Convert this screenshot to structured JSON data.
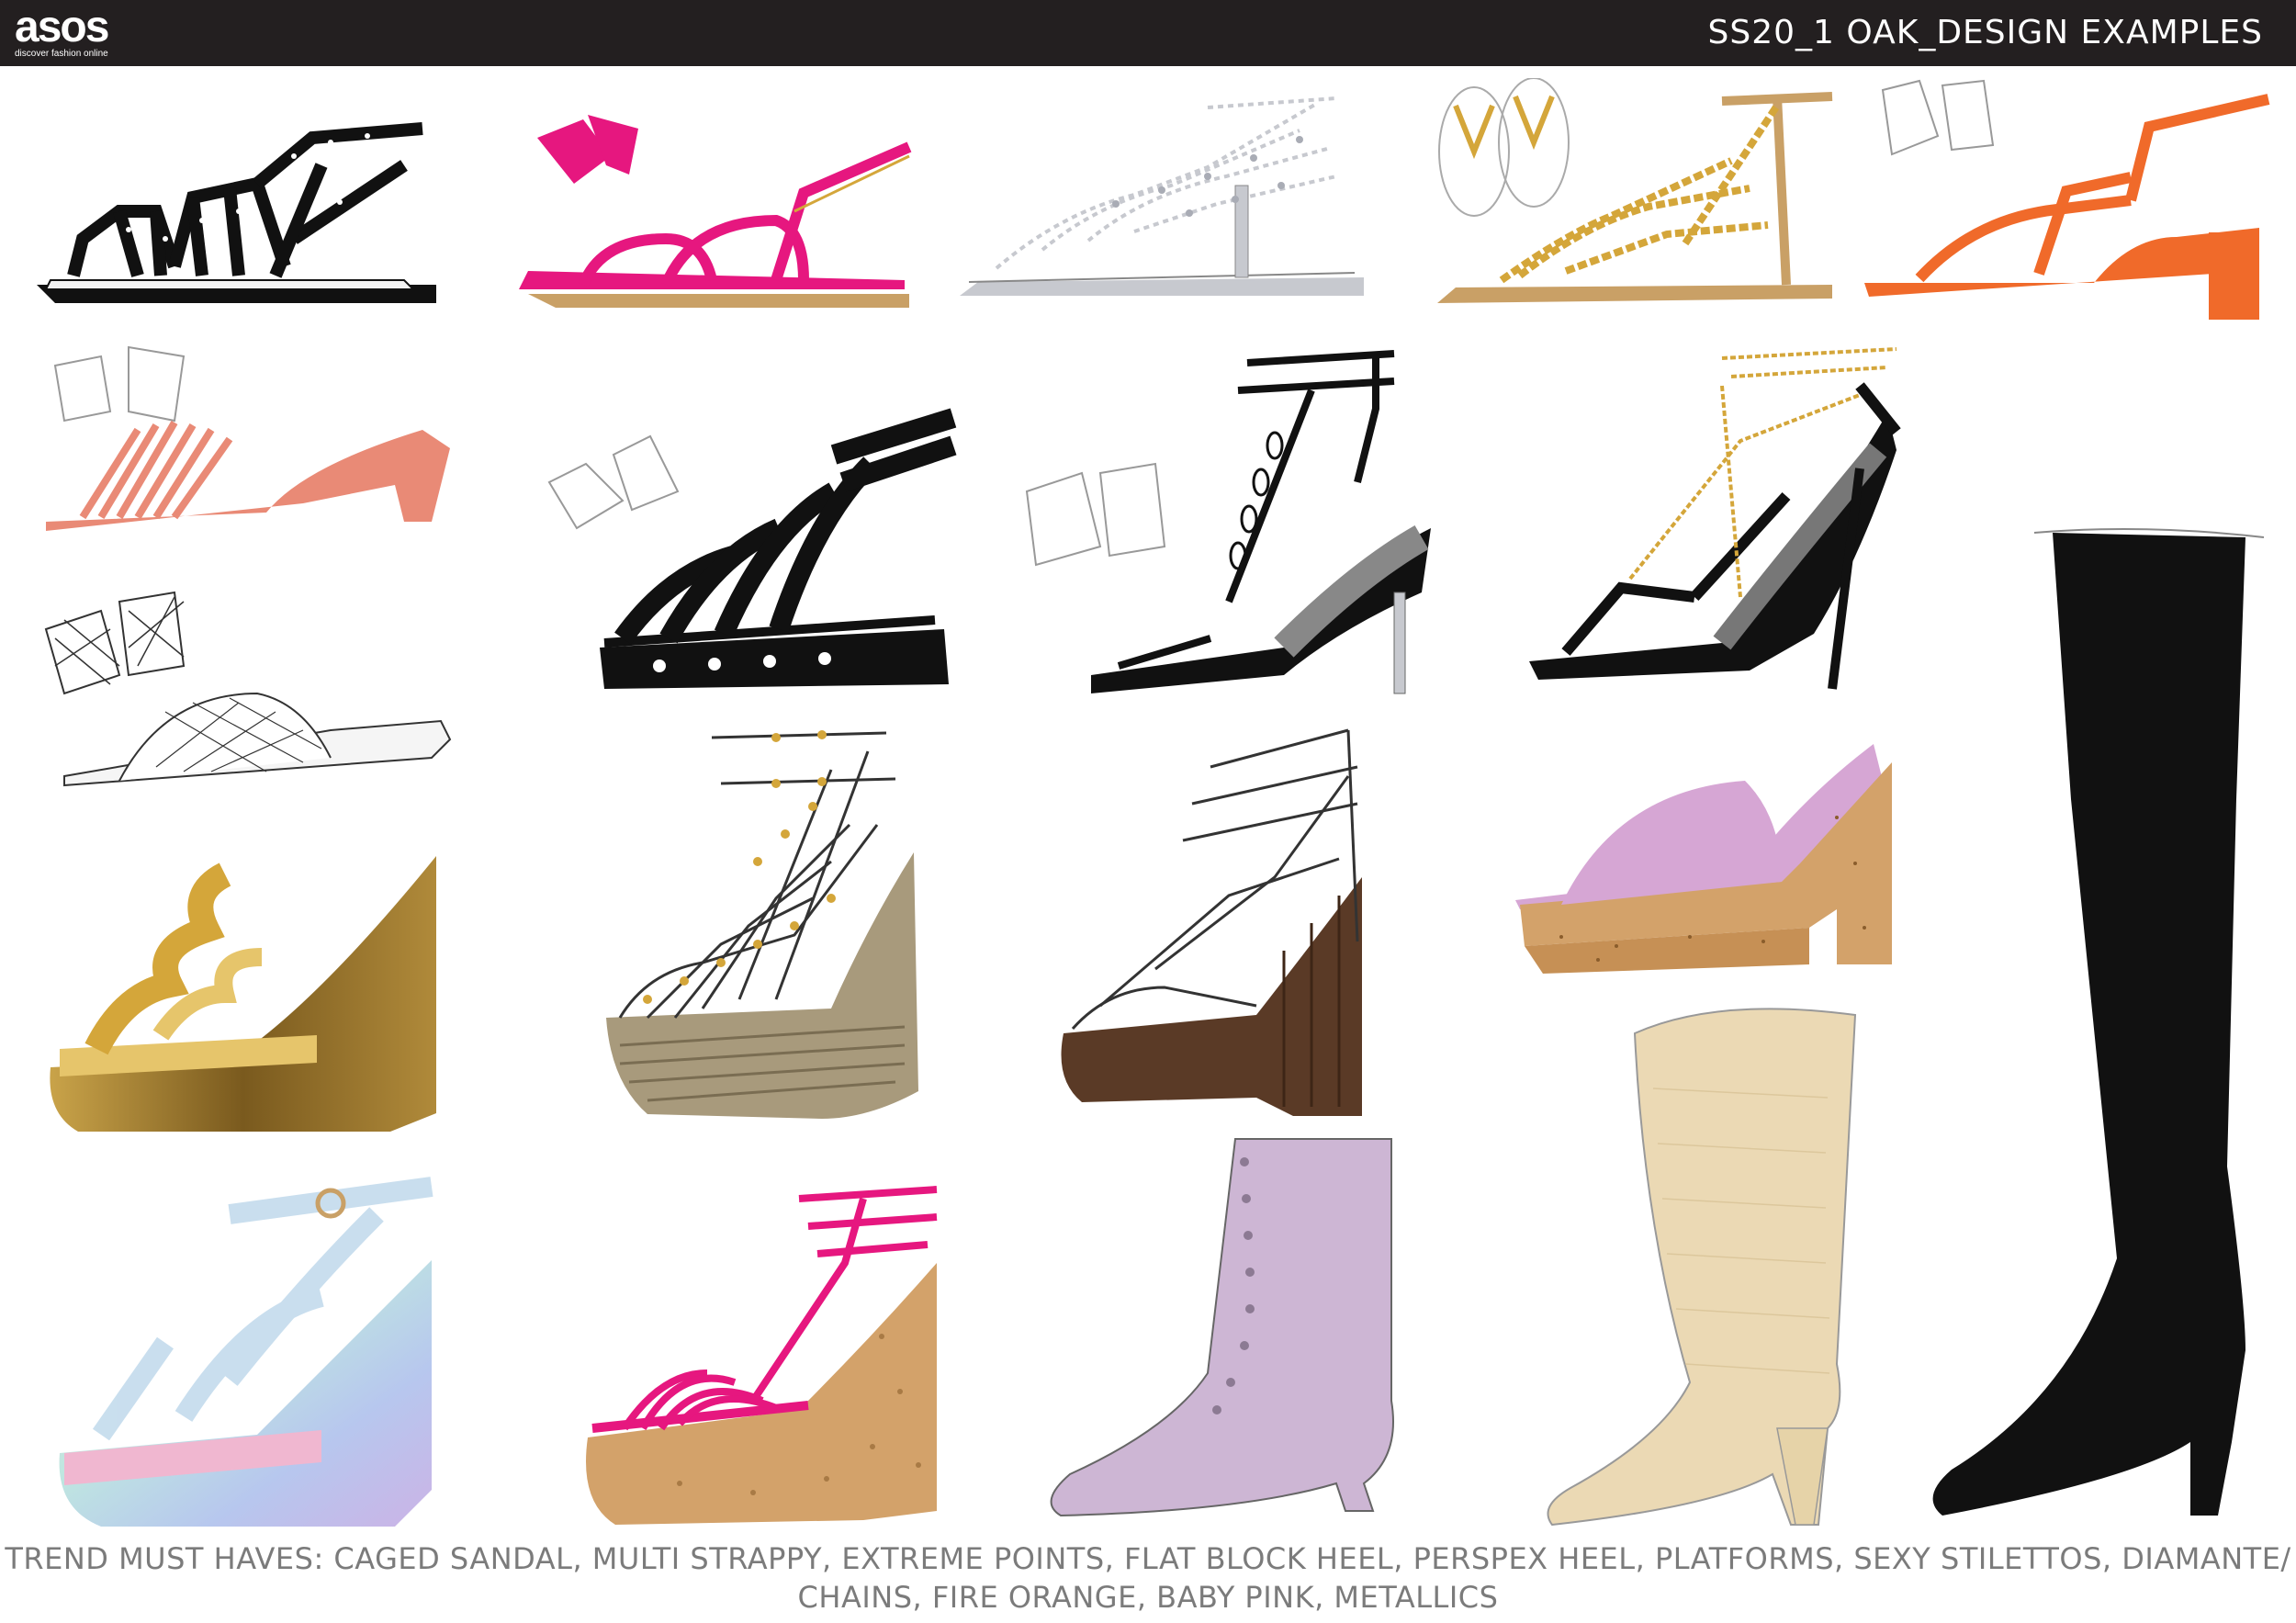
{
  "header": {
    "logo_text": "asos",
    "logo_tagline": "discover fashion online",
    "title": "SS20_1 OAK_DESIGN EXAMPLES"
  },
  "footer": {
    "line1": "TREND MUST HAVES: CAGED SANDAL, MULTI STRAPPY, EXTREME POINTS, FLAT BLOCK HEEL, PERSPEX HEEL, PLATFORMS, SEXY STILETTOS, DIAMANTE/",
    "line2": "CHAINS, FIRE ORANGE, BABY PINK, METALLICS"
  },
  "colors": {
    "header_bg": "#231f20",
    "black": "#111111",
    "hot_pink": "#e6177f",
    "tan": "#c9a066",
    "gold": "#d4a63a",
    "silver": "#c7c9cf",
    "fire_orange": "#f06a2a",
    "coral": "#e98a76",
    "cork": "#d3a26a",
    "bronze": "#7a5a1e",
    "wood": "#5a3a26",
    "jute": "#a89a7c",
    "lilac_sock": "#cdb6d4",
    "cream": "#ebd9b4",
    "baby_pink": "#d6a6d4",
    "caption_gray": "#7b7b7b"
  },
  "illustrations": [
    {
      "id": "shoe-1",
      "description": "black caged studded flat sandal",
      "color_key": "black"
    },
    {
      "id": "shoe-2",
      "description": "hot pink strappy flat sandal",
      "color_key": "hot_pink"
    },
    {
      "id": "shoe-3",
      "description": "silver diamante toe post flat sandal",
      "color_key": "silver"
    },
    {
      "id": "shoe-4",
      "description": "gold chain toe post flat sandal",
      "color_key": "gold"
    },
    {
      "id": "shoe-5",
      "description": "fire orange block heel sandal",
      "color_key": "fire_orange"
    },
    {
      "id": "shoe-6",
      "description": "coral multi strap mule",
      "color_key": "coral"
    },
    {
      "id": "shoe-7",
      "description": "black lace-up flatform sandal",
      "color_key": "black"
    },
    {
      "id": "shoe-8",
      "description": "black perspex stiletto sandal",
      "color_key": "black"
    },
    {
      "id": "shoe-9",
      "description": "black chain stiletto sandal",
      "color_key": "black"
    },
    {
      "id": "shoe-10",
      "description": "white quilted wedge mule",
      "color_key": "silver"
    },
    {
      "id": "shoe-11",
      "description": "metallic gold wave wedge",
      "color_key": "bronze"
    },
    {
      "id": "shoe-12",
      "description": "white studded espadrille wedge",
      "color_key": "jute"
    },
    {
      "id": "shoe-13",
      "description": "white lace-up wooden wedge",
      "color_key": "wood"
    },
    {
      "id": "shoe-14",
      "description": "baby pink cork platform mule",
      "color_key": "baby_pink"
    },
    {
      "id": "shoe-15",
      "description": "black over-the-knee boot",
      "color_key": "black"
    },
    {
      "id": "shoe-16",
      "description": "iridescent perspex wedge",
      "color_key": "silver"
    },
    {
      "id": "shoe-17",
      "description": "hot pink cork wedge",
      "color_key": "hot_pink"
    },
    {
      "id": "shoe-18",
      "description": "lilac pointed sock boot",
      "color_key": "lilac_sock"
    },
    {
      "id": "shoe-19",
      "description": "cream western boot",
      "color_key": "cream"
    }
  ]
}
